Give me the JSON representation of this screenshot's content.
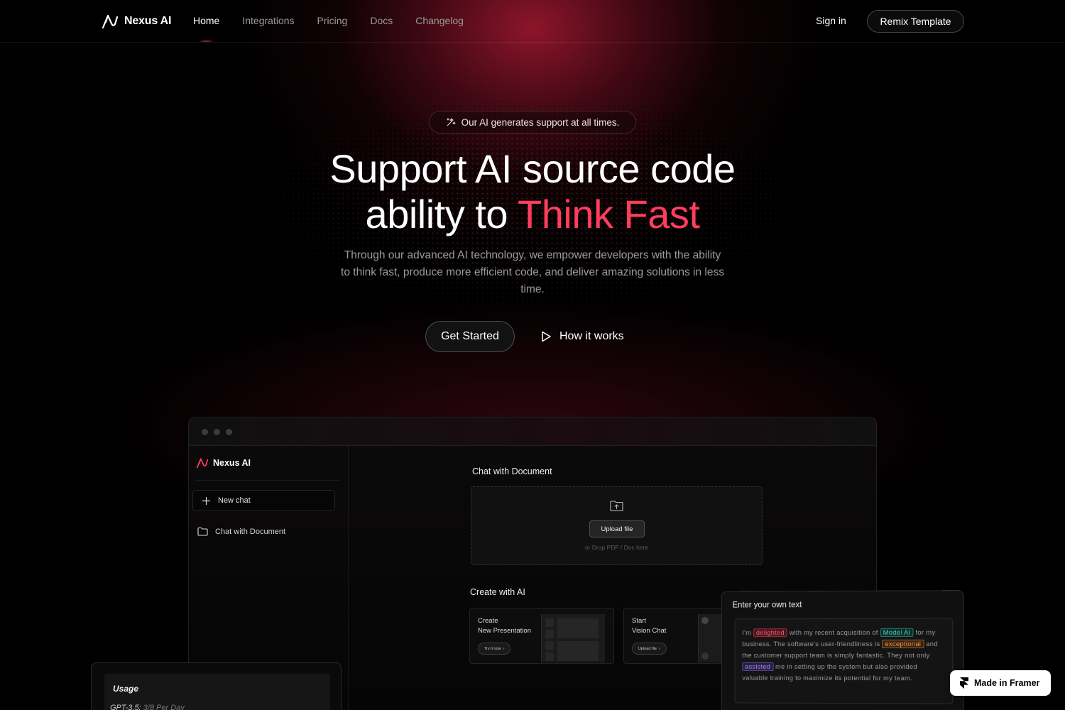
{
  "brand": {
    "name": "Nexus AI",
    "accent": "#ff3d5e"
  },
  "nav": {
    "links": [
      {
        "label": "Home",
        "active": true
      },
      {
        "label": "Integrations",
        "active": false
      },
      {
        "label": "Pricing",
        "active": false
      },
      {
        "label": "Docs",
        "active": false
      },
      {
        "label": "Changelog",
        "active": false
      }
    ],
    "sign_in": "Sign in",
    "remix": "Remix Template"
  },
  "hero": {
    "pill": "Our AI generates support at all times.",
    "title_line1": "Support AI source code",
    "title_line2_prefix": "ability to ",
    "title_line2_accent": "Think Fast",
    "subtitle": "Through our advanced AI technology, we empower developers with the ability to think fast, produce more efficient code, and deliver amazing solutions in less time.",
    "cta_primary": "Get Started",
    "cta_secondary": "How it works"
  },
  "app": {
    "sidebar": {
      "logo": "Nexus AI",
      "new_chat": "New chat",
      "items": [
        "Chat with Document"
      ]
    },
    "chat_doc": {
      "title": "Chat with Document",
      "upload_button": "Upload file",
      "drop_hint": "or Drop PDF / Doc here"
    },
    "create": {
      "title": "Create with AI",
      "cards": [
        {
          "line1": "Create",
          "line2": "New Presentation",
          "button": "Try it now"
        },
        {
          "line1": "Start",
          "line2": "Vision Chat",
          "button": "Upload file"
        }
      ]
    },
    "text_panel": {
      "title": "Enter your own text",
      "segments": [
        {
          "text": "I'm ",
          "tag": null
        },
        {
          "text": "delighted",
          "tag": "red"
        },
        {
          "text": " with my recent acquisition of ",
          "tag": null
        },
        {
          "text": "Model AI",
          "tag": "teal"
        },
        {
          "text": " for my business. The software's user-friendliness is ",
          "tag": null
        },
        {
          "text": "exceptional",
          "tag": "orange"
        },
        {
          "text": " and the customer support team is simply fantastic. They not only ",
          "tag": null
        },
        {
          "text": "assisted",
          "tag": "purple"
        },
        {
          "text": " me in setting up the system but also provided valuable training to maximize its potential for my team.",
          "tag": null
        }
      ]
    },
    "usage": {
      "title": "Usage",
      "model": "GPT-3.5:",
      "limit": "3/8 Per Day"
    }
  },
  "framer_badge": "Made in Framer"
}
